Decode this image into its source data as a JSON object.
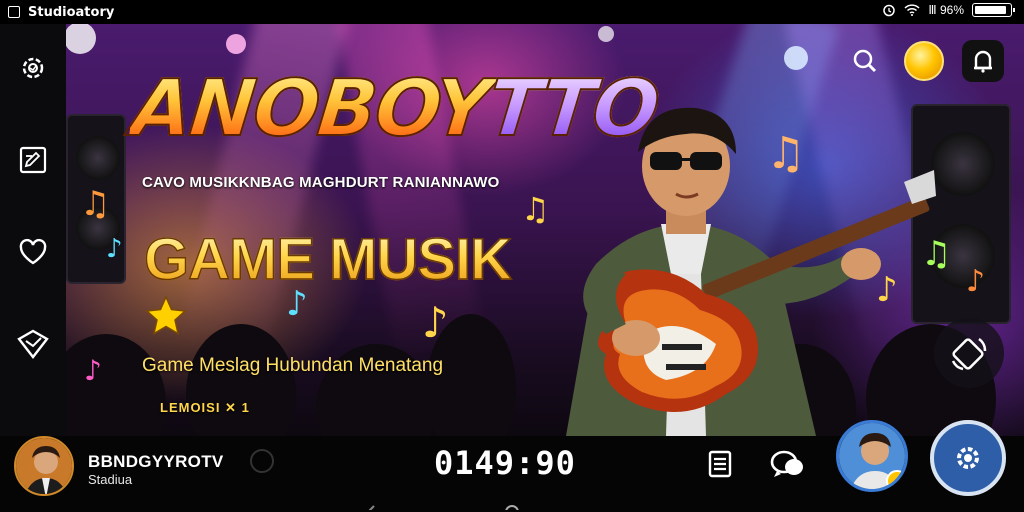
{
  "status_bar": {
    "app_name": "Studioatory",
    "right_text": "Ⅲ 96%",
    "battery_level": 0.9
  },
  "banner": {
    "logo_main": "ANOBOY",
    "logo_accent": "TTO",
    "tagline": "CAVO MUSIKKNBAG MAGHDURT RANIANNAWO",
    "game_title": "GAME MUSIK",
    "subtitle": "Game Meslag Hubundan Menatang",
    "level_text": "LEMOISI ✕ 1"
  },
  "player": {
    "name": "BBNDGYYROTV",
    "status": "Stadiua"
  },
  "timer": "0149:90",
  "icons": {
    "left_rail": [
      "settings-gear-icon",
      "edit-note-icon",
      "heart-icon",
      "shield-check-icon"
    ],
    "top_right": [
      "search-icon",
      "coin-icon",
      "notification-icon"
    ],
    "bottom": [
      "menu-list-icon",
      "chat-bubble-icon",
      "settings-gear-icon"
    ]
  },
  "colors": {
    "accent_gold": "#ffc53a",
    "accent_purple": "#7c3aed",
    "settings_blue": "#2f5ea8"
  }
}
